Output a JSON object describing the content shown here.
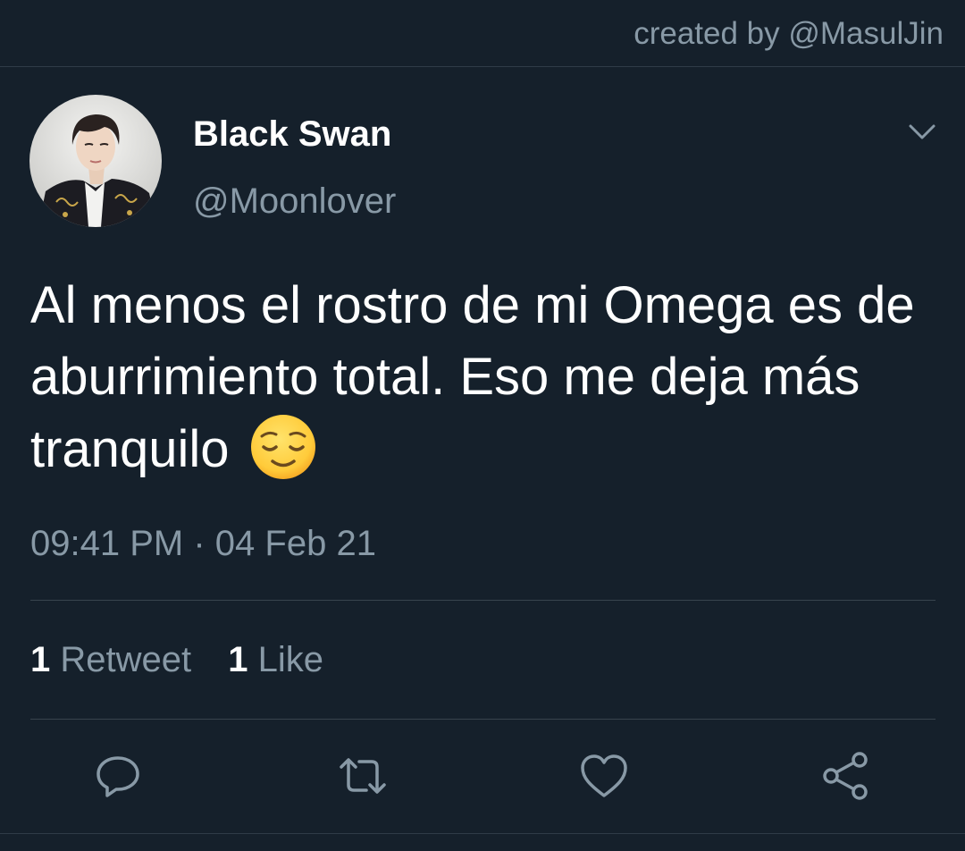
{
  "header": {
    "credit": "created by @MasulJin"
  },
  "tweet": {
    "author": {
      "display_name": "Black Swan",
      "handle": "@Moonlover",
      "avatar_icon": "avatar-photo"
    },
    "text": "Al menos el rostro de mi Omega es de aburrimiento total. Eso me deja más tranquilo",
    "emoji": "relieved-face-emoji",
    "time": "09:41 PM",
    "separator": "·",
    "date": "04 Feb 21",
    "stats": {
      "retweets_count": "1",
      "retweets_label": "Retweet",
      "likes_count": "1",
      "likes_label": "Like"
    },
    "actions": [
      "reply-icon",
      "retweet-icon",
      "like-icon",
      "share-icon"
    ]
  },
  "colors": {
    "background": "#15202b",
    "primary_text": "#ffffff",
    "secondary_text": "#8899a6",
    "divider": "#38444d"
  }
}
